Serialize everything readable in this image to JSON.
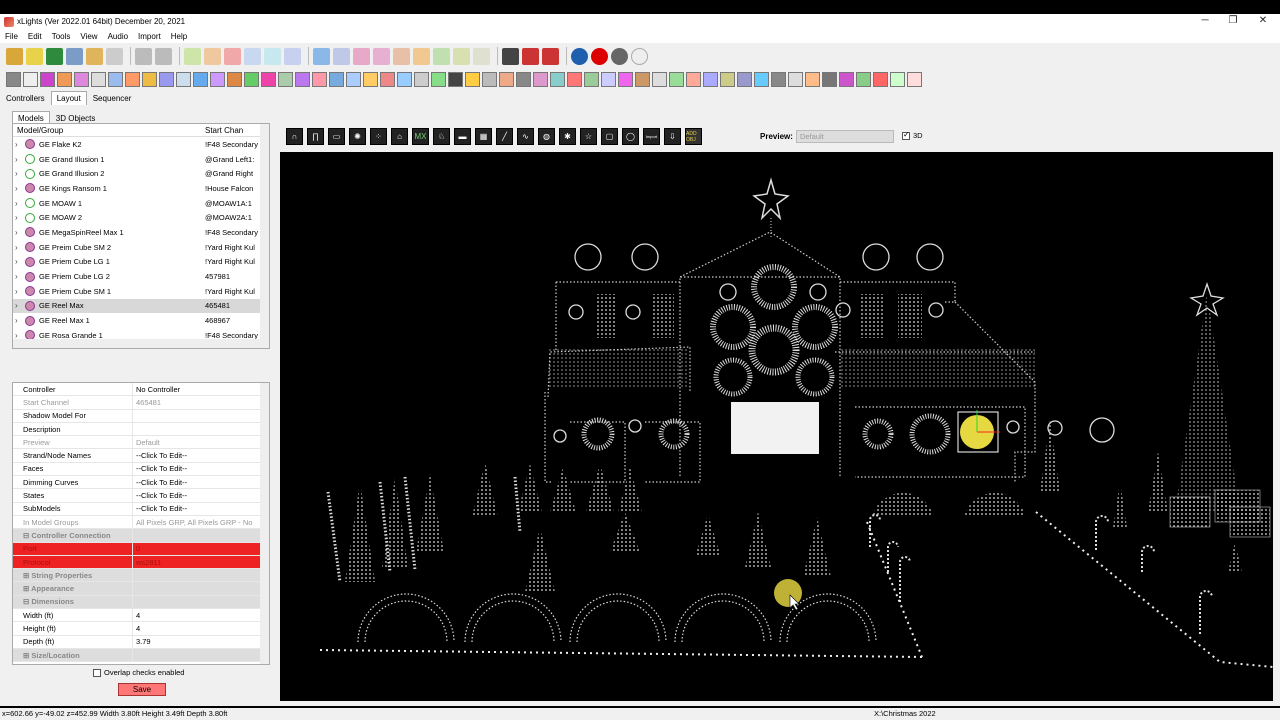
{
  "window": {
    "title": "xLights (Ver 2022.01 64bit) December 20, 2021",
    "minimize": "─",
    "maximize": "❐",
    "close": "✕"
  },
  "menu": [
    "File",
    "Edit",
    "Tools",
    "View",
    "Audio",
    "Import",
    "Help"
  ],
  "main_tabs": [
    "Controllers",
    "Layout",
    "Sequencer"
  ],
  "sub_tabs": [
    "Models",
    "3D Objects"
  ],
  "tree": {
    "header_model": "Model/Group",
    "header_start": "Start Chan",
    "rows": [
      {
        "name": "GE Flake K2",
        "start": "!F48 Secondary",
        "icon": "p"
      },
      {
        "name": "GE Grand Illusion 1",
        "start": "@Grand Left1:",
        "icon": "g"
      },
      {
        "name": "GE Grand Illusion 2",
        "start": "@Grand Right",
        "icon": "g"
      },
      {
        "name": "GE Kings Ransom 1",
        "start": "!House Falcon",
        "icon": "p"
      },
      {
        "name": "GE MOAW 1",
        "start": "@MOAW1A:1",
        "icon": "g"
      },
      {
        "name": "GE MOAW 2",
        "start": "@MOAW2A:1",
        "icon": "g"
      },
      {
        "name": "GE MegaSpinReel Max 1",
        "start": "!F48 Secondary",
        "icon": "p"
      },
      {
        "name": "GE Preim Cube SM 2",
        "start": "!Yard Right Kul",
        "icon": "p"
      },
      {
        "name": "GE Priem Cube LG 1",
        "start": "!Yard Right Kul",
        "icon": "p"
      },
      {
        "name": "GE Priem Cube LG 2",
        "start": "457981",
        "icon": "p"
      },
      {
        "name": "GE Priem Cube SM 1",
        "start": "!Yard Right Kul",
        "icon": "p"
      },
      {
        "name": "GE Reel Max",
        "start": "465481",
        "icon": "p",
        "selected": true
      },
      {
        "name": "GE Reel Max 1",
        "start": "468967",
        "icon": "p"
      },
      {
        "name": "GE Rosa Grande 1",
        "start": "!F48 Secondary",
        "icon": "p"
      }
    ]
  },
  "props": [
    {
      "k": "Controller",
      "v": "No Controller"
    },
    {
      "k": "Start Channel",
      "v": "465481",
      "cls": "dis"
    },
    {
      "k": "Shadow Model For",
      "v": ""
    },
    {
      "k": "Description",
      "v": ""
    },
    {
      "k": "Preview",
      "v": "Default",
      "cls": "dis"
    },
    {
      "k": "Strand/Node Names",
      "v": "--Click To Edit--"
    },
    {
      "k": "Faces",
      "v": "--Click To Edit--"
    },
    {
      "k": "Dimming Curves",
      "v": "--Click To Edit--"
    },
    {
      "k": "States",
      "v": "--Click To Edit--"
    },
    {
      "k": "SubModels",
      "v": "--Click To Edit--"
    },
    {
      "k": "In Model Groups",
      "v": "All Pixels GRP, All Pixels GRP - No",
      "cls": "dis"
    },
    {
      "k": "⊟ Controller Connection",
      "v": "",
      "cls": "cat"
    },
    {
      "k": "Port",
      "v": "0",
      "cls": "red"
    },
    {
      "k": "Protocol",
      "v": "ws2811",
      "cls": "red"
    },
    {
      "k": "⊞ String Properties",
      "v": "",
      "cls": "cat"
    },
    {
      "k": "⊞ Appearance",
      "v": "",
      "cls": "cat"
    },
    {
      "k": "⊟ Dimensions",
      "v": "",
      "cls": "cat"
    },
    {
      "k": "Width (ft)",
      "v": "4"
    },
    {
      "k": "Height (ft)",
      "v": "4"
    },
    {
      "k": "Depth (ft)",
      "v": "3.79"
    },
    {
      "k": "⊞ Size/Location",
      "v": "",
      "cls": "cat"
    }
  ],
  "overlap_label": "Overlap checks enabled",
  "save_label": "Save",
  "preview": {
    "label": "Preview:",
    "value": "Default",
    "three_d": "3D"
  },
  "palette_text": {
    "mx": "MX",
    "import": "Import",
    "add": "ADD OBJ"
  },
  "status": {
    "left": "x=602.66 y=-49.02 z=452.99 Width 3.80ft Height 3.49ft Depth 3.80ft",
    "right": "X:\\Christmas 2022"
  }
}
